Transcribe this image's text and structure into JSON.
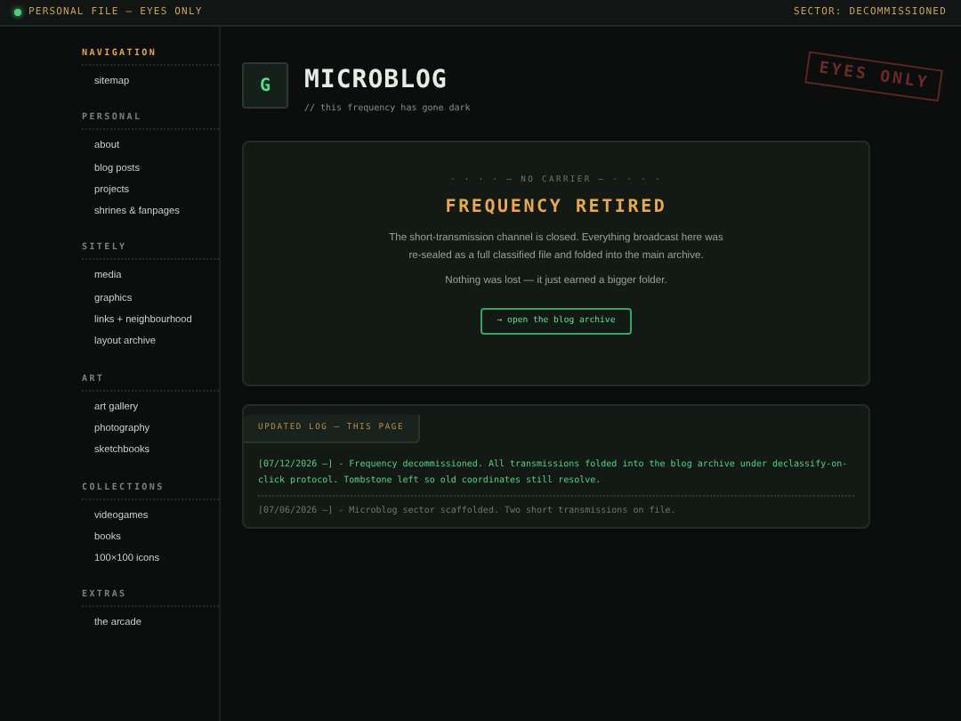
{
  "top_bar": {
    "left": "PERSONAL FILE — EYES ONLY",
    "right": "SECTOR: DECOMMISSIONED"
  },
  "sidebar": {
    "sections": [
      {
        "heading": "NAVIGATION",
        "highlighted": true,
        "items": [
          "sitemap"
        ]
      },
      {
        "heading": "PERSONAL",
        "highlighted": false,
        "items": [
          "about",
          "blog posts",
          "projects",
          "shrines & fanpages"
        ]
      },
      {
        "heading": "SITELY",
        "highlighted": false,
        "items": [
          "media",
          "graphics",
          "links + neighbourhood",
          "layout archive"
        ]
      },
      {
        "heading": "ART",
        "highlighted": false,
        "items": [
          "art gallery",
          "photography",
          "sketchbooks"
        ]
      },
      {
        "heading": "COLLECTIONS",
        "highlighted": false,
        "items": [
          "videogames",
          "books",
          "100×100 icons"
        ]
      },
      {
        "heading": "EXTRAS",
        "highlighted": false,
        "items": [
          "the arcade"
        ]
      }
    ]
  },
  "header": {
    "logo": "G",
    "title": "MICROBLOG",
    "subtitle": "// this frequency has gone dark",
    "stamp": "EYES ONLY"
  },
  "notice": {
    "kicker": "· · · · — NO CARRIER — · · · ·",
    "title": "FREQUENCY RETIRED",
    "paragraphs": [
      "The short-transmission channel is closed. Everything broadcast here was re-sealed as a full classified file and folded into the main archive.",
      "Nothing was lost — it just earned a bigger folder."
    ],
    "button": "→ open the blog archive"
  },
  "log": {
    "title": "UPDATED LOG — THIS PAGE",
    "entries": [
      {
        "date": "[07/12/2026 —]",
        "text": " - Frequency decommissioned. All transmissions folded into the blog archive under declassify-on-click protocol. Tombstone left so old coordinates still resolve.",
        "highlighted": true
      },
      {
        "date": "[07/06/2026 —]",
        "text": " - Microblog sector scaffolded. Two short transmissions on file.",
        "highlighted": false
      }
    ]
  }
}
